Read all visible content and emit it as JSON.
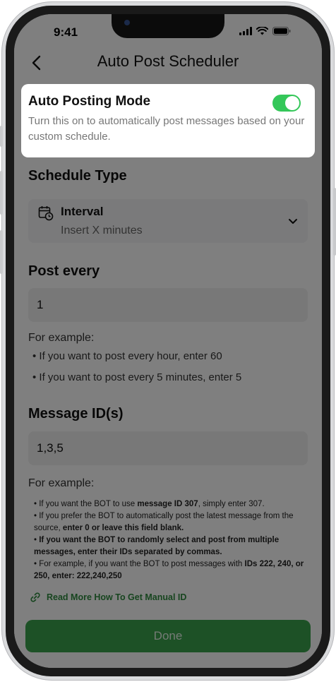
{
  "status": {
    "time": "9:41"
  },
  "nav": {
    "title": "Auto Post Scheduler"
  },
  "auto_posting": {
    "title": "Auto Posting Mode",
    "description": "Turn this on to automatically post messages based on your custom schedule.",
    "enabled": true
  },
  "schedule_type": {
    "title": "Schedule Type",
    "selected_label": "Interval",
    "selected_sub": "Insert X minutes"
  },
  "post_every": {
    "title": "Post every",
    "value": "1",
    "example_title": "For example:",
    "examples": [
      "If you want to post every hour, enter 60",
      "If you want to post every 5 minutes, enter 5"
    ]
  },
  "message_ids": {
    "title": "Message ID(s)",
    "value": "1,3,5",
    "example_title": "For example:",
    "line1_pre": "If you want the BOT to use ",
    "line1_bold": "message ID 307",
    "line1_post": ", simply enter 307.",
    "line2_pre": "If you prefer the BOT to automatically post the latest message from the source, ",
    "line2_bold": "enter 0 or leave this field blank.",
    "line3_bold": "If you want the BOT to randomly select and post from multiple messages, enter their IDs separated by commas.",
    "line4_pre": "For example, if you want the BOT to post messages with ",
    "line4_bold": "IDs 222, 240, or 250, enter: 222,240,250"
  },
  "link": {
    "label": "Read More How To Get Manual ID"
  },
  "done": {
    "label": "Done"
  },
  "colors": {
    "accent": "#3aa34c",
    "toggle_on": "#34c759"
  }
}
